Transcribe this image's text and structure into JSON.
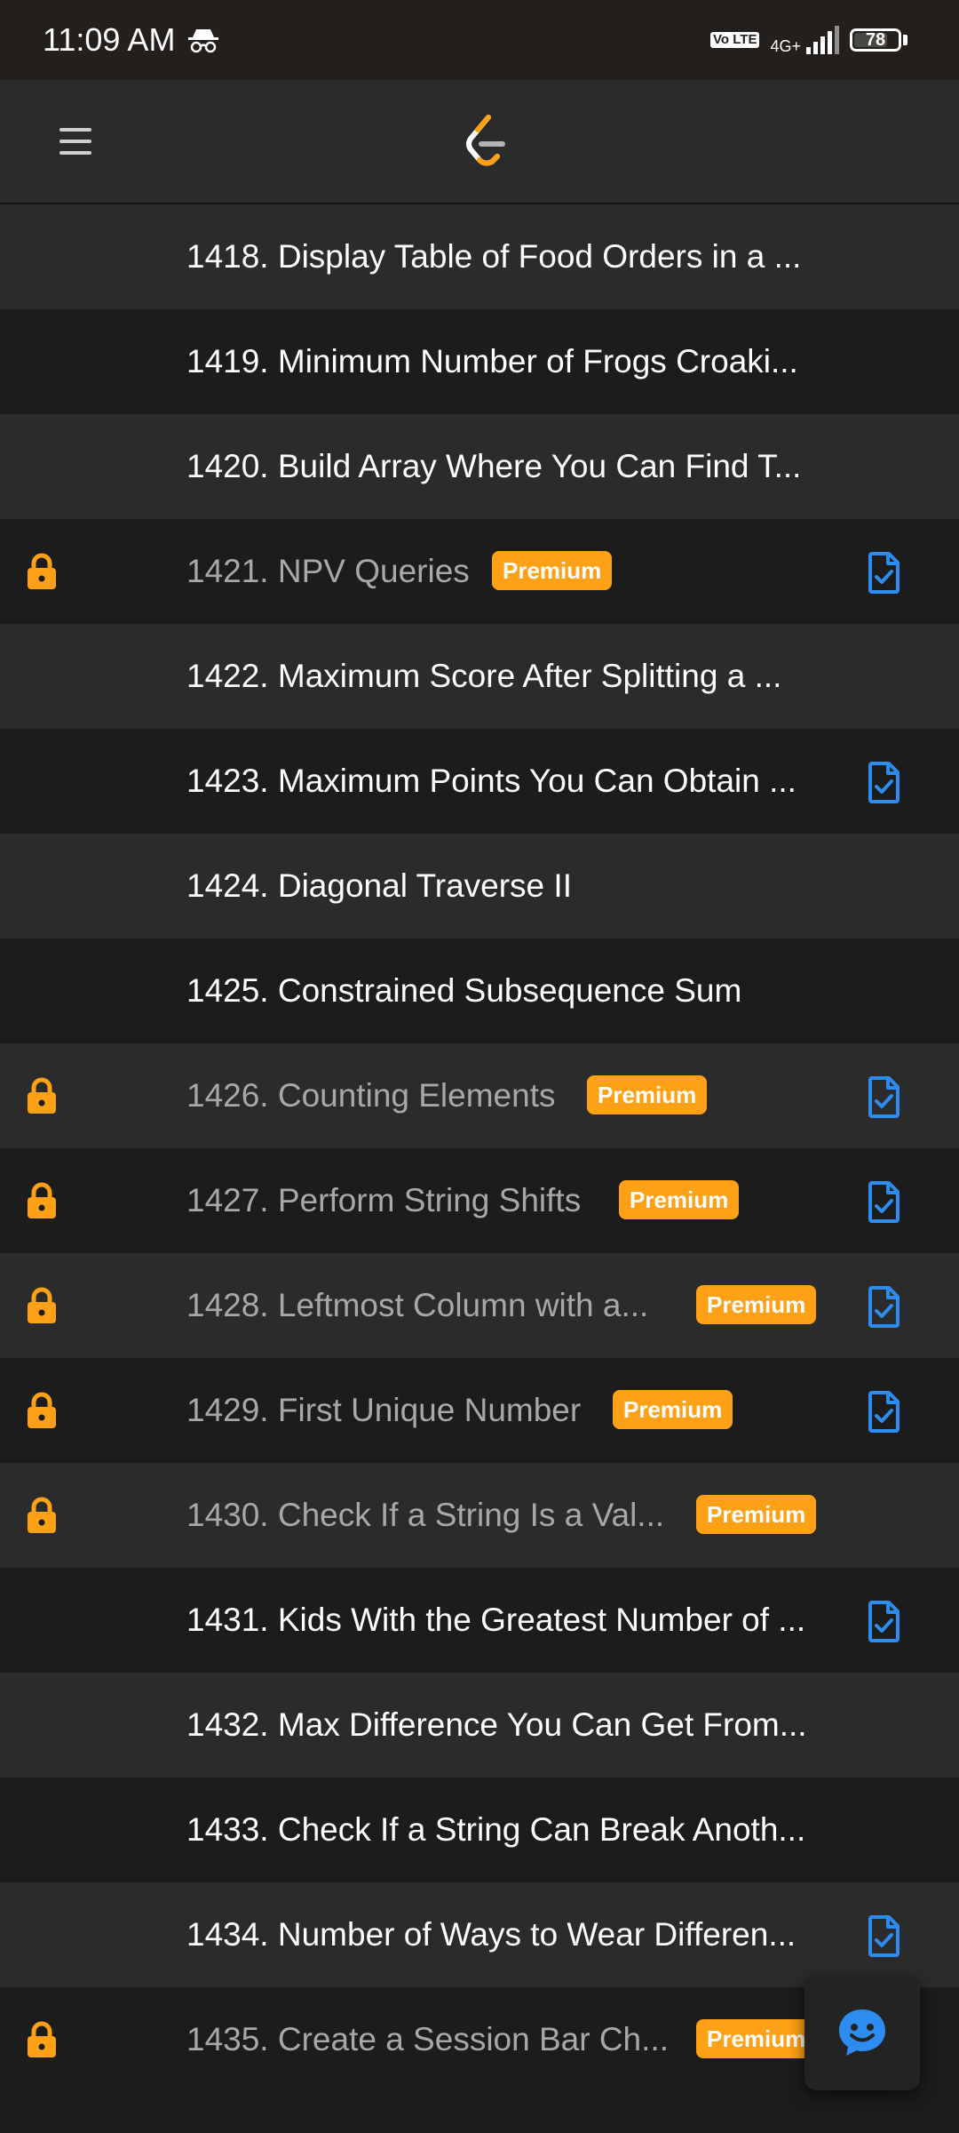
{
  "status_bar": {
    "time": "11:09 AM",
    "incognito_icon": "incognito-icon",
    "volte": "Vo LTE",
    "network": "4G+",
    "battery": "78",
    "battery_level": 0.78
  },
  "app_bar": {
    "menu_icon": "hamburger-menu-icon",
    "logo": "leetcode-logo"
  },
  "colors": {
    "premium_badge": "#ffa116",
    "lock": "#ffa116",
    "solution_icon": "#2d8cf0",
    "row_light": "#2b2b2b",
    "row_dark": "#1c1c1c"
  },
  "problems": [
    {
      "title": "1418. Display Table of Food Orders in a ...",
      "premium": false,
      "solution": false
    },
    {
      "title": "1419. Minimum Number of Frogs Croaki...",
      "premium": false,
      "solution": false
    },
    {
      "title": "1420. Build Array Where You Can Find T...",
      "premium": false,
      "solution": false
    },
    {
      "title": "1421. NPV Queries",
      "premium": true,
      "badge": "Premium",
      "solution": true
    },
    {
      "title": "1422. Maximum Score After Splitting a ...",
      "premium": false,
      "solution": false
    },
    {
      "title": "1423. Maximum Points You Can Obtain ...",
      "premium": false,
      "solution": true
    },
    {
      "title": "1424. Diagonal Traverse II",
      "premium": false,
      "solution": false
    },
    {
      "title": "1425. Constrained Subsequence Sum",
      "premium": false,
      "solution": false
    },
    {
      "title": "1426. Counting Elements",
      "premium": true,
      "badge": "Premium",
      "solution": true
    },
    {
      "title": "1427. Perform String Shifts",
      "premium": true,
      "badge": "Premium",
      "solution": true
    },
    {
      "title": "1428. Leftmost Column with a...",
      "premium": true,
      "badge": "Premium",
      "solution": true
    },
    {
      "title": "1429. First Unique Number",
      "premium": true,
      "badge": "Premium",
      "solution": true
    },
    {
      "title": "1430. Check If a String Is a Val...",
      "premium": true,
      "badge": "Premium",
      "solution": false
    },
    {
      "title": "1431. Kids With the Greatest Number of ...",
      "premium": false,
      "solution": true
    },
    {
      "title": "1432. Max Difference You Can Get From...",
      "premium": false,
      "solution": false
    },
    {
      "title": "1433. Check If a String Can Break Anoth...",
      "premium": false,
      "solution": false
    },
    {
      "title": "1434. Number of Ways to Wear Differen...",
      "premium": false,
      "solution": true
    },
    {
      "title": "1435. Create a Session Bar Ch...",
      "premium": true,
      "badge": "Premium",
      "solution": false
    }
  ],
  "fab": {
    "icon": "chat-support-icon"
  }
}
